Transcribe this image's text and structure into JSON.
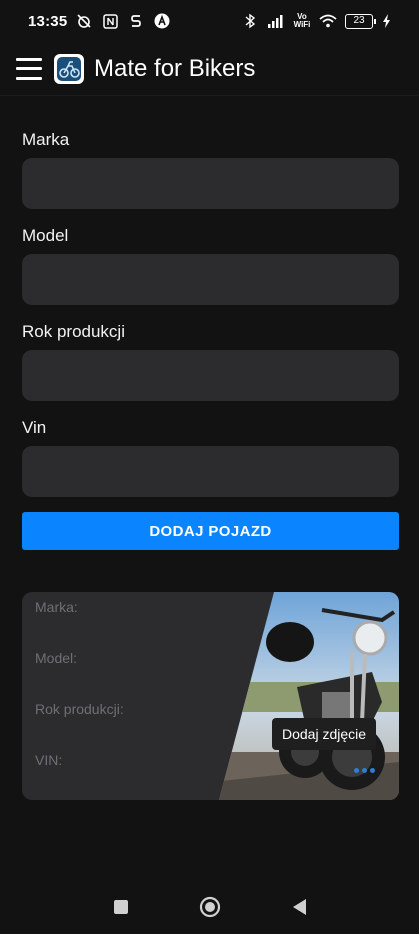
{
  "status_bar": {
    "time": "13:35",
    "battery": "23",
    "icons": [
      "alarm-off-icon",
      "nfc-icon",
      "s-icon",
      "a-icon",
      "bluetooth-icon",
      "signal-icon",
      "vowifi-icon",
      "wifi-icon",
      "battery-icon",
      "charging-icon"
    ],
    "vowifi_label": "Vo WiFi"
  },
  "app_bar": {
    "title": "Mate for Bikers",
    "menu_icon": "hamburger-menu-icon",
    "logo_icon": "app-logo-icon"
  },
  "form": {
    "fields": [
      {
        "label": "Marka",
        "value": "",
        "placeholder": ""
      },
      {
        "label": "Model",
        "value": "",
        "placeholder": ""
      },
      {
        "label": "Rok produkcji",
        "value": "",
        "placeholder": ""
      },
      {
        "label": "Vin",
        "value": "",
        "placeholder": ""
      }
    ],
    "submit_label": "DODAJ POJAZD"
  },
  "preview": {
    "lines": [
      "Marka:",
      "Model:",
      "Rok produkcji:",
      "VIN:"
    ],
    "photo_button_label": "Dodaj zdjęcie"
  },
  "colors": {
    "background": "#121212",
    "input_bg": "#2c2c2f",
    "accent": "#0a84ff",
    "muted_text": "#6f6f74"
  },
  "nav_bar": {
    "icons": [
      "recents-square-icon",
      "home-circle-icon",
      "back-triangle-icon"
    ]
  }
}
